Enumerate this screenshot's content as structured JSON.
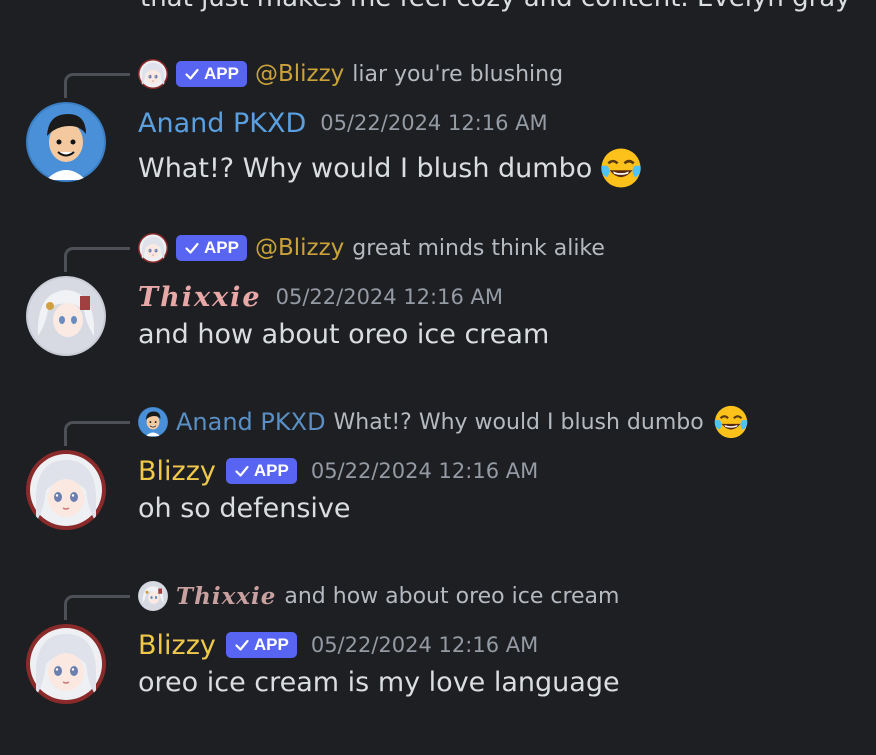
{
  "partial_top_text": "that just makes me feel cozy and content. Evelyn gray",
  "messages": [
    {
      "reply": {
        "badge": "APP",
        "mention": "@Blizzy",
        "text": "liar you're blushing"
      },
      "author": "Anand PKXD",
      "timestamp": "05/22/2024 12:16 AM",
      "content": "What!? Why would I blush dumbo",
      "emoji": "face-with-tears-of-joy"
    },
    {
      "reply": {
        "badge": "APP",
        "mention": "@Blizzy",
        "text": "great minds think alike"
      },
      "author": "Thixxie",
      "timestamp": "05/22/2024 12:16 AM",
      "content": "and how about oreo ice cream"
    },
    {
      "reply": {
        "author": "Anand PKXD",
        "text": "What!? Why would I blush dumbo",
        "emoji": "face-with-tears-of-joy"
      },
      "author": "Blizzy",
      "badge": "APP",
      "timestamp": "05/22/2024 12:16 AM",
      "content": "oh so defensive"
    },
    {
      "reply": {
        "author": "Thixxie",
        "text": "and how about oreo ice cream"
      },
      "author": "Blizzy",
      "badge": "APP",
      "timestamp": "05/22/2024 12:16 AM",
      "content": "oreo ice cream is my love language"
    }
  ],
  "colors": {
    "background": "#1e1f22",
    "anand_name": "#5aa0e0",
    "blizzy_name": "#f0c94a",
    "thixxie_name": "#e8a8a8",
    "app_badge": "#5865f2",
    "timestamp": "#949ba4"
  }
}
